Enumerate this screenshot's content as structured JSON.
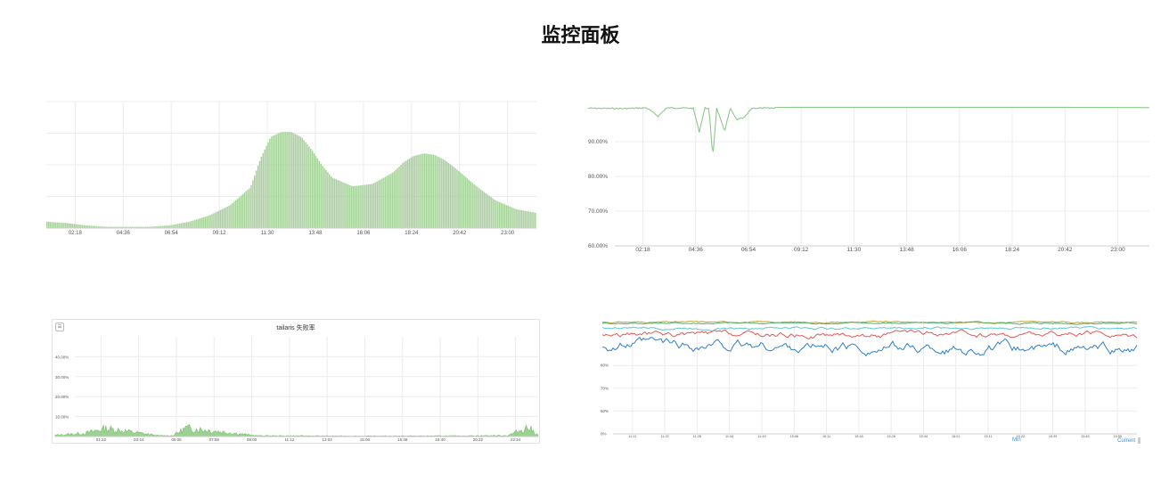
{
  "page_title": "监控面板",
  "chart_data": [
    {
      "type": "bar",
      "title": "",
      "x_ticks": [
        "02:18",
        "04:36",
        "06:54",
        "09:12",
        "11:30",
        "13:48",
        "16:06",
        "18:24",
        "20:42",
        "23:00"
      ],
      "x_range": [
        "00:00",
        "24:00"
      ],
      "ylim": [
        0,
        100
      ],
      "grid": true,
      "series": [
        {
          "color": "#a8d29c",
          "x": [
            "00:00",
            "01:00",
            "02:00",
            "03:00",
            "04:00",
            "05:00",
            "06:00",
            "07:00",
            "08:00",
            "09:00",
            "10:00",
            "10:30",
            "11:00",
            "11:30",
            "12:00",
            "12:30",
            "13:00",
            "13:30",
            "14:00",
            "15:00",
            "16:00",
            "17:00",
            "17:30",
            "18:00",
            "18:30",
            "19:00",
            "19:30",
            "20:00",
            "21:00",
            "22:00",
            "23:00",
            "24:00"
          ],
          "values": [
            5,
            4,
            2,
            1,
            1,
            1,
            2,
            5,
            10,
            18,
            32,
            55,
            72,
            76,
            76,
            72,
            62,
            50,
            40,
            33,
            35,
            44,
            52,
            57,
            59,
            58,
            54,
            48,
            34,
            22,
            15,
            12
          ]
        }
      ]
    },
    {
      "type": "line",
      "title": "",
      "x_ticks": [
        "02:18",
        "04:36",
        "06:54",
        "09:12",
        "11:30",
        "13:48",
        "16:06",
        "18:24",
        "20:42",
        "23:00"
      ],
      "y_ticks": [
        "60.00%",
        "70.00%",
        "80.00%",
        "90.00%"
      ],
      "ylim": [
        60,
        100
      ],
      "grid": true,
      "series": [
        {
          "color": "#8cc98a",
          "x": [
            "00:00",
            "01:30",
            "02:30",
            "03:00",
            "03:20",
            "03:30",
            "04:30",
            "04:45",
            "05:00",
            "05:10",
            "05:20",
            "05:30",
            "05:50",
            "06:05",
            "06:20",
            "06:40",
            "07:00",
            "09:00",
            "12:00",
            "16:00",
            "20:00",
            "24:00"
          ],
          "values": [
            99.8,
            99.7,
            99.9,
            97.5,
            99.8,
            99.9,
            99.8,
            93.0,
            99.9,
            99.7,
            86.0,
            99.8,
            93.2,
            99.8,
            96.5,
            97.0,
            99.8,
            99.9,
            99.9,
            99.9,
            99.9,
            99.8
          ]
        }
      ]
    },
    {
      "type": "area",
      "title": "tailaris 失败率",
      "x_ticks": [
        "01:22",
        "03:44",
        "05:06",
        "07:08",
        "09:00",
        "11:12",
        "13:04",
        "15:06",
        "16:48",
        "18:40",
        "20:32",
        "22:24"
      ],
      "y_ticks": [
        "10.00%",
        "20.00%",
        "30.00%",
        "40.00%"
      ],
      "ylim": [
        0,
        50
      ],
      "grid": true,
      "series": [
        {
          "color": "#7cc26f",
          "x": [
            "00:00",
            "01:30",
            "02:30",
            "05:10",
            "05:50",
            "06:30",
            "07:10",
            "10:00",
            "15:00",
            "20:00",
            "22:30",
            "23:30",
            "24:00"
          ],
          "values": [
            0.8,
            2.0,
            4.8,
            0.5,
            0.6,
            5.0,
            4.2,
            0.5,
            0.3,
            0.4,
            0.6,
            5.5,
            0.8
          ]
        }
      ]
    },
    {
      "type": "line",
      "title": "",
      "x_ticks": [
        "11:11",
        "11:22",
        "11:28",
        "11:34",
        "11:49",
        "15:06",
        "15:11",
        "15:18",
        "15:28",
        "15:34",
        "15:01",
        "15:11",
        "15:22",
        "15:39",
        "15:45",
        "15:55"
      ],
      "y_ticks": [
        "0%",
        "60%",
        "70%",
        "80%"
      ],
      "legend": [
        "Min",
        "Current"
      ],
      "ylim": [
        50,
        100
      ],
      "grid": true,
      "series": [
        {
          "color": "#c9a23a",
          "mean": 99.0,
          "jitter": 0.4
        },
        {
          "color": "#4fb06b",
          "mean": 98.6,
          "jitter": 0.5
        },
        {
          "color": "#5bc8cf",
          "mean": 96.5,
          "jitter": 0.7
        },
        {
          "color": "#e25a56",
          "mean": 93.5,
          "jitter": 1.6
        },
        {
          "color": "#2f7fc8",
          "mean": 89.0,
          "jitter": 3.0
        }
      ]
    }
  ]
}
